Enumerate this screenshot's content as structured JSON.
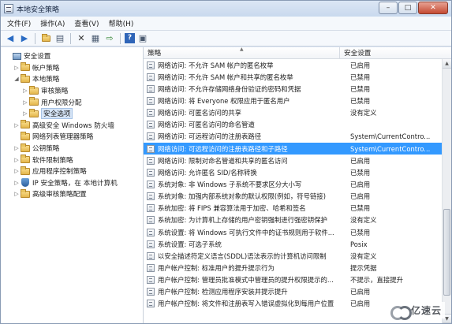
{
  "window": {
    "title": "本地安全策略"
  },
  "window_buttons": {
    "minimize": "–",
    "maximize": "□",
    "close": "✕"
  },
  "menu": [
    "文件(F)",
    "操作(A)",
    "查看(V)",
    "帮助(H)"
  ],
  "toolbar": [
    "back-icon",
    "forward-icon",
    "up-folder-icon",
    "show-hide-tree-icon",
    "delete-icon",
    "properties-icon",
    "export-icon",
    "help-icon",
    "console-icon"
  ],
  "tree": [
    {
      "label": "安全设置",
      "level": 0,
      "expander": "",
      "icon": "computer"
    },
    {
      "label": "帐户策略",
      "level": 1,
      "expander": "▷",
      "icon": "folder"
    },
    {
      "label": "本地策略",
      "level": 1,
      "expander": "◢",
      "icon": "folder"
    },
    {
      "label": "审核策略",
      "level": 2,
      "expander": "▷",
      "icon": "folder"
    },
    {
      "label": "用户权限分配",
      "level": 2,
      "expander": "▷",
      "icon": "folder"
    },
    {
      "label": "安全选项",
      "level": 2,
      "expander": "▷",
      "icon": "folder",
      "selected": true
    },
    {
      "label": "高级安全 Windows 防火墙",
      "level": 1,
      "expander": "▷",
      "icon": "folder"
    },
    {
      "label": "网络列表管理器策略",
      "level": 1,
      "expander": "",
      "icon": "folder"
    },
    {
      "label": "公钥策略",
      "level": 1,
      "expander": "▷",
      "icon": "folder"
    },
    {
      "label": "软件限制策略",
      "level": 1,
      "expander": "▷",
      "icon": "folder"
    },
    {
      "label": "应用程序控制策略",
      "level": 1,
      "expander": "▷",
      "icon": "folder"
    },
    {
      "label": "IP 安全策略，在 本地计算机",
      "level": 1,
      "expander": "▷",
      "icon": "shield"
    },
    {
      "label": "高级审核策略配置",
      "level": 1,
      "expander": "▷",
      "icon": "folder"
    }
  ],
  "list": {
    "headers": {
      "policy": "策略",
      "setting": "安全设置"
    },
    "rows": [
      {
        "name": "网络访问: 不允许 SAM 帐户的匿名枚举",
        "value": "已启用"
      },
      {
        "name": "网络访问: 不允许 SAM 帐户和共享的匿名枚举",
        "value": "已禁用"
      },
      {
        "name": "网络访问: 不允许存储网络身份验证的密码和凭据",
        "value": "已禁用"
      },
      {
        "name": "网络访问: 将 Everyone 权限应用于匿名用户",
        "value": "已禁用"
      },
      {
        "name": "网络访问: 可匿名访问的共享",
        "value": "没有定义"
      },
      {
        "name": "网络访问: 可匿名访问的命名管道",
        "value": ""
      },
      {
        "name": "网络访问: 可远程访问的注册表路径",
        "value": "System\\CurrentContro..."
      },
      {
        "name": "网络访问: 可远程访问的注册表路径和子路径",
        "value": "System\\CurrentContro...",
        "selected": true
      },
      {
        "name": "网络访问: 限制对命名管道和共享的匿名访问",
        "value": "已启用"
      },
      {
        "name": "网络访问: 允许匿名 SID/名称转换",
        "value": "已禁用"
      },
      {
        "name": "系统对象: 非 Windows 子系统不要求区分大小写",
        "value": "已启用"
      },
      {
        "name": "系统对象: 加强内部系统对象的默认权限(例如，符号链接)",
        "value": "已启用"
      },
      {
        "name": "系统加密: 将 FIPS 兼容算法用于加密、哈希和签名",
        "value": "已禁用"
      },
      {
        "name": "系统加密: 为计算机上存储的用户密钥强制进行强密钥保护",
        "value": "没有定义"
      },
      {
        "name": "系统设置: 将 Windows 可执行文件中的证书规则用于软件...",
        "value": "已禁用"
      },
      {
        "name": "系统设置: 可选子系统",
        "value": "Posix"
      },
      {
        "name": "以安全描述符定义语言(SDDL)语法表示的计算机访问限制",
        "value": "没有定义"
      },
      {
        "name": "用户帐户控制: 标准用户的提升提示行为",
        "value": "提示凭据"
      },
      {
        "name": "用户帐户控制: 管理员批准模式中管理员的提升权限提示的...",
        "value": "不提示，直接提升"
      },
      {
        "name": "用户帐户控制: 检测应用程序安装并提示提升",
        "value": "已启用"
      },
      {
        "name": "用户帐户控制: 将文件和注册表写入错误虚拟化到每用户位置",
        "value": "已启用"
      }
    ]
  },
  "watermark": {
    "text": "亿速云"
  }
}
